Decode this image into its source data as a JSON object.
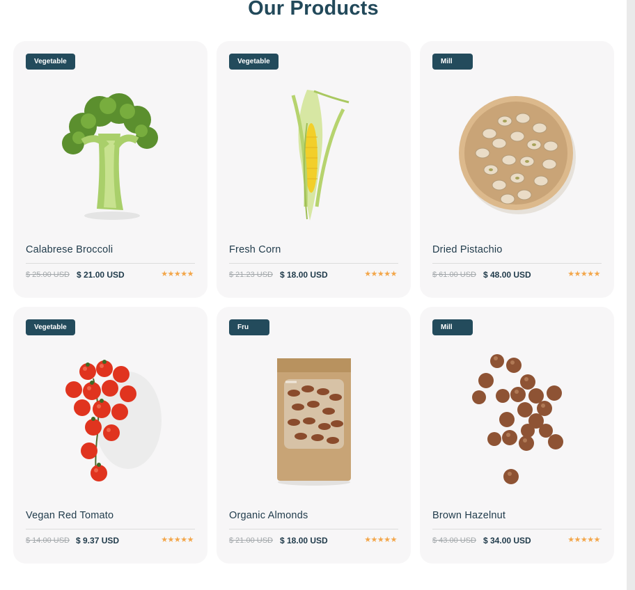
{
  "section_title": "Our Products",
  "products": [
    {
      "badge": "Vegetable",
      "name": "Calabrese Broccoli",
      "old_price": "$ 25.00 USD",
      "new_price": "$ 21.00 USD",
      "rating": "★★★★★",
      "image": "broccoli"
    },
    {
      "badge": "Vegetable",
      "name": "Fresh Corn",
      "old_price": "$ 21.23 USD",
      "new_price": "$ 18.00 USD",
      "rating": "★★★★★",
      "image": "corn"
    },
    {
      "badge": "Mill",
      "name": "Dried Pistachio",
      "old_price": "$ 61.00 USD",
      "new_price": "$ 48.00 USD",
      "rating": "★★★★★",
      "image": "pistachio"
    },
    {
      "badge": "Vegetable",
      "name": "Vegan Red Tomato",
      "old_price": "$ 14.00 USD",
      "new_price": "$ 9.37 USD",
      "rating": "★★★★★",
      "image": "tomato"
    },
    {
      "badge": "Fru",
      "name": "Organic Almonds",
      "old_price": "$ 21.00 USD",
      "new_price": "$ 18.00 USD",
      "rating": "★★★★★",
      "image": "almonds"
    },
    {
      "badge": "Mill",
      "name": "Brown Hazelnut",
      "old_price": "$ 43.00 USD",
      "new_price": "$ 34.00 USD",
      "rating": "★★★★★",
      "image": "hazelnut"
    }
  ],
  "colors": {
    "accent": "#234b5c",
    "star": "#f3a64a",
    "card_bg": "#f7f6f7"
  }
}
